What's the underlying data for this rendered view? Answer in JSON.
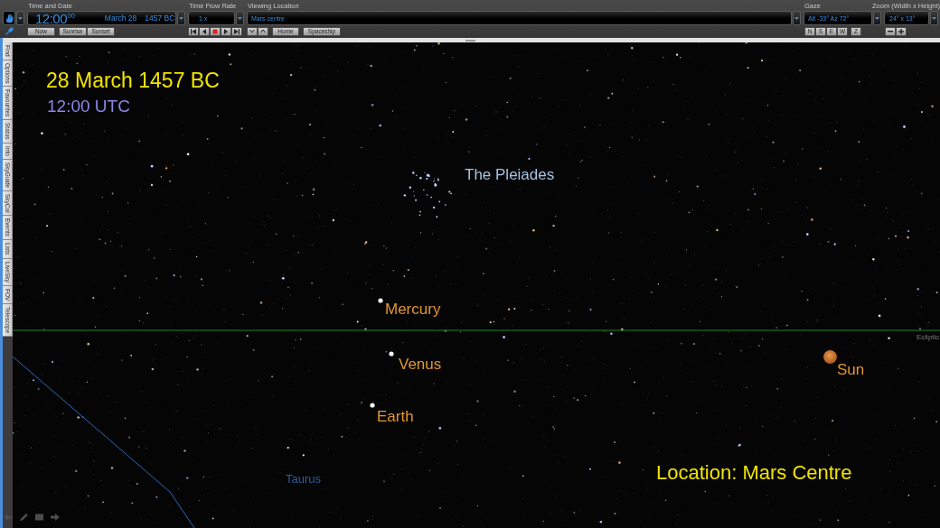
{
  "toolbar": {
    "time_date": {
      "label": "Time and Date",
      "time": "12:00",
      "seconds": "00",
      "date": "March 28",
      "year": "1457 BC",
      "buttons": [
        "Now",
        "Sunrise",
        "Sunset"
      ]
    },
    "time_flow": {
      "label": "Time Flow Rate",
      "value": "1 x"
    },
    "location": {
      "label": "Viewing Location",
      "value": "Mars centre",
      "buttons": [
        "Home",
        "Spaceship"
      ]
    },
    "gaze": {
      "label": "Gaze",
      "value": "Alt -33° Az 72°",
      "buttons": [
        "N",
        "S",
        "E",
        "W",
        "Z"
      ]
    },
    "zoom": {
      "label": "Zoom (Width x Height)",
      "value": "24° x 13°"
    }
  },
  "sidebar": {
    "tabs": [
      "Find",
      "Options",
      "Favourites",
      "Status",
      "Info",
      "SkyGuide",
      "SkyCal",
      "Events",
      "Lists",
      "LiveSky",
      "FOV",
      "Telescope"
    ]
  },
  "sky": {
    "date": "28 March 1457 BC",
    "time": "12:00 UTC",
    "objects": [
      {
        "kind": "cluster",
        "name": "The Pleiades"
      },
      {
        "kind": "planet",
        "name": "Mercury"
      },
      {
        "kind": "planet",
        "name": "Venus"
      },
      {
        "kind": "planet",
        "name": "Earth"
      },
      {
        "kind": "star",
        "name": "Sun"
      }
    ],
    "ecliptic": "Ecliptic",
    "constellation": "Taurus",
    "location": "Location: Mars Centre"
  }
}
